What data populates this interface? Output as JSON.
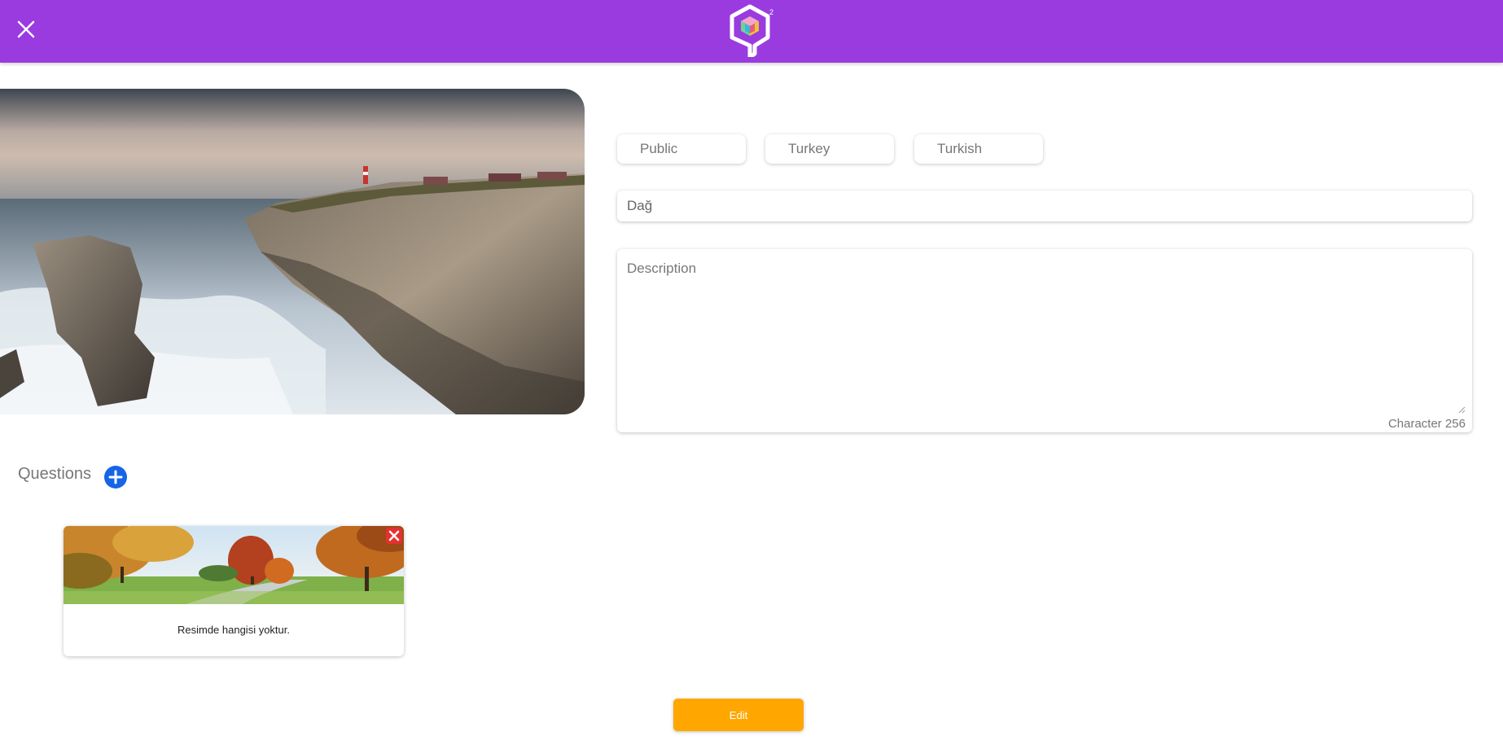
{
  "header": {
    "close_icon": "close-icon",
    "logo_icon": "cube-q-logo-icon",
    "background_color": "#9a3be0"
  },
  "cover_image": {
    "subject": "coastal-cliff-lighthouse-photo"
  },
  "filters": {
    "visibility": "Public",
    "country": "Turkey",
    "language": "Turkish"
  },
  "form": {
    "name_value": "Dağ",
    "description_placeholder": "Description",
    "character_counter": "Character 256"
  },
  "questions": {
    "label": "Questions",
    "add_icon": "plus-circle-icon",
    "add_color": "#1565e6",
    "items": [
      {
        "text": "Resimde hangisi yoktur.",
        "image": "autumn-park-photo",
        "remove_icon": "close-square-icon"
      }
    ]
  },
  "actions": {
    "edit_label": "Edit",
    "edit_color": "#ffa700"
  }
}
